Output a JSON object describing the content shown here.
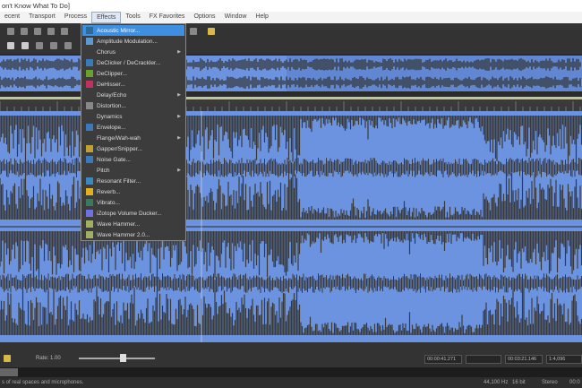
{
  "window": {
    "title": "on't Know What To Do]"
  },
  "menubar": [
    "ecent",
    "Transport",
    "Process",
    "Effects",
    "Tools",
    "FX Favorites",
    "Options",
    "Window",
    "Help"
  ],
  "effects_menu": [
    {
      "label": "Acoustic Mirror...",
      "icon": "mirror-icon",
      "color": "#2d6a9a",
      "highlighted": true
    },
    {
      "label": "Amplitude Modulation...",
      "icon": "modulation-icon",
      "color": "#5a9ad0"
    },
    {
      "label": "Chorus",
      "submenu": true
    },
    {
      "label": "DeClicker / DeCrackler...",
      "icon": "declick-icon",
      "color": "#3a7ab8"
    },
    {
      "label": "DeClipper...",
      "icon": "declip-icon",
      "color": "#6aa030"
    },
    {
      "label": "DeHisser...",
      "icon": "dehiss-icon",
      "color": "#c03060"
    },
    {
      "label": "Delay/Echo",
      "submenu": true
    },
    {
      "label": "Distortion...",
      "icon": "distortion-icon",
      "color": "#888"
    },
    {
      "label": "Dynamics",
      "submenu": true
    },
    {
      "label": "Envelope...",
      "icon": "envelope-icon",
      "color": "#3a7ab8"
    },
    {
      "label": "Flange/Wah-wah",
      "submenu": true
    },
    {
      "label": "Gapper/Snipper...",
      "icon": "gapper-icon",
      "color": "#c0a030"
    },
    {
      "label": "Noise Gate...",
      "icon": "noise-gate-icon",
      "color": "#3a7ab8"
    },
    {
      "label": "Pitch",
      "submenu": true
    },
    {
      "label": "Resonant Filter...",
      "icon": "filter-icon",
      "color": "#3a8ac0"
    },
    {
      "label": "Reverb...",
      "icon": "reverb-icon",
      "color": "#e0b020"
    },
    {
      "label": "Vibrato...",
      "icon": "vibrato-icon",
      "color": "#3a7a5a"
    },
    {
      "label": "iZotope Volume Ducker...",
      "icon": "volume-icon",
      "color": "#7070e0"
    },
    {
      "label": "Wave Hammer...",
      "icon": "hammer-icon",
      "color": "#a0b060"
    },
    {
      "label": "Wave Hammer 2.0...",
      "icon": "hammer-icon",
      "color": "#a0b060"
    }
  ],
  "bottombar": {
    "rate": "Rate: 1.00",
    "rate_value": 1.0,
    "position": "00:00:41.271",
    "length": "00:03:21.146",
    "ratio": "1:4,096"
  },
  "status": {
    "text": "s of real spaces and microphones.",
    "sample_rate": "44,100 Hz",
    "bit_depth": "16 bit",
    "channels": "Stereo",
    "extra": "00:0"
  },
  "colors": {
    "wave_bg": "#6b93e0",
    "wave_fg": "#3a3a3a",
    "highlight": "#3e8fe0"
  }
}
